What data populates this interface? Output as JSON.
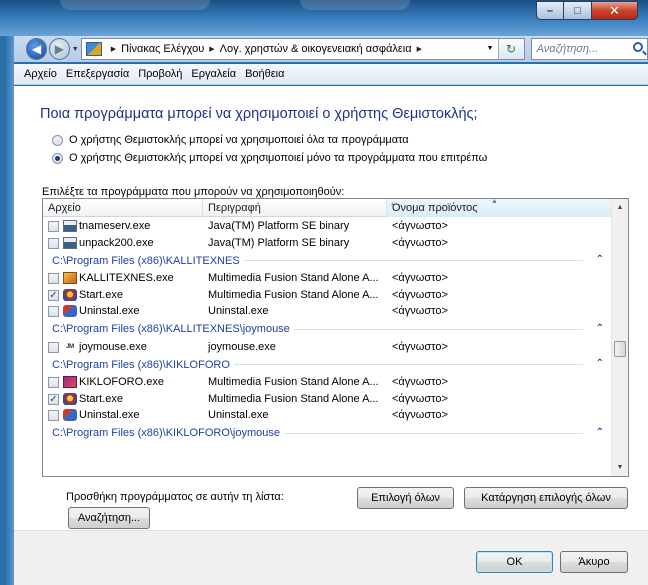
{
  "window": {
    "minimize_glyph": "–",
    "maximize_glyph": "□",
    "close_glyph": "✕"
  },
  "navigation": {
    "breadcrumbs": [
      "Πίνακας Ελέγχου",
      "Λογ. χρηστών & οικογενειακή ασφάλεια"
    ],
    "search_placeholder": "Αναζήτηση..."
  },
  "menu": {
    "items": [
      "Αρχείο",
      "Επεξεργασία",
      "Προβολή",
      "Εργαλεία",
      "Βοήθεια"
    ]
  },
  "page": {
    "heading": "Ποια προγράμματα μπορεί να χρησιμοποιεί ο χρήστης Θεμιστοκλής;",
    "radio_all": "Ο χρήστης Θεμιστοκλής μπορεί να χρησιμοποιεί όλα τα προγράμματα",
    "radio_allowed": "Ο χρήστης Θεμιστοκλής μπορεί να χρησιμοποιεί μόνο τα προγράμματα που επιτρέπω",
    "selected_option": "allowed",
    "list_caption": "Επιλέξτε τα προγράμματα που μπορούν να χρησιμοποιηθούν:"
  },
  "programs": {
    "columns": [
      "Αρχείο",
      "Περιγραφή",
      "Όνομα προϊόντος"
    ],
    "sorted_column": "Όνομα προϊόντος",
    "entries": [
      {
        "kind": "row",
        "file": "tnameserv.exe",
        "description": "Java(TM) Platform SE binary",
        "product": "<άγνωστο>",
        "checked": false,
        "icon": "java-icon"
      },
      {
        "kind": "row",
        "file": "unpack200.exe",
        "description": "Java(TM) Platform SE binary",
        "product": "<άγνωστο>",
        "checked": false,
        "icon": "java-icon"
      },
      {
        "kind": "group",
        "path": "C:\\Program Files (x86)\\KALLITEXNES"
      },
      {
        "kind": "row",
        "file": "KALLITEXNES.exe",
        "description": "Multimedia Fusion Stand Alone A...",
        "product": "<άγνωστο>",
        "checked": false,
        "icon": "kallitexnes-icon"
      },
      {
        "kind": "row",
        "file": "Start.exe",
        "description": "Multimedia Fusion Stand Alone A...",
        "product": "<άγνωστο>",
        "checked": true,
        "icon": "start-icon"
      },
      {
        "kind": "row",
        "file": "Uninstal.exe",
        "description": "Uninstal.exe",
        "product": "<άγνωστο>",
        "checked": false,
        "icon": "uninstall-icon"
      },
      {
        "kind": "group",
        "path": "C:\\Program Files (x86)\\KALLITEXNES\\joymouse"
      },
      {
        "kind": "row",
        "file": "joymouse.exe",
        "description": "joymouse.exe",
        "product": "<άγνωστο>",
        "checked": false,
        "icon": "joymouse-icon"
      },
      {
        "kind": "group",
        "path": "C:\\Program Files (x86)\\KIKLOFORO"
      },
      {
        "kind": "row",
        "file": "KIKLOFORO.exe",
        "description": "Multimedia Fusion Stand Alone A...",
        "product": "<άγνωστο>",
        "checked": false,
        "icon": "kikloforo-icon"
      },
      {
        "kind": "row",
        "file": "Start.exe",
        "description": "Multimedia Fusion Stand Alone A...",
        "product": "<άγνωστο>",
        "checked": true,
        "icon": "start-icon"
      },
      {
        "kind": "row",
        "file": "Uninstal.exe",
        "description": "Uninstal.exe",
        "product": "<άγνωστο>",
        "checked": false,
        "icon": "uninstall-icon"
      },
      {
        "kind": "group",
        "path": "C:\\Program Files (x86)\\KIKLOFORO\\joymouse"
      }
    ],
    "collapse_glyph": "⌃",
    "scroll_position": 0.55
  },
  "actions": {
    "add_label": "Προσθήκη προγράμματος σε αυτήν τη λίστα:",
    "browse": "Αναζήτηση...",
    "select_all": "Επιλογή όλων",
    "clear_all": "Κατάργηση επιλογής όλων",
    "ok": "OK",
    "cancel": "Άκυρο"
  },
  "colors": {
    "heading": "#1e3287",
    "group_header": "#1e40a8",
    "frame": "#2e73b2"
  }
}
